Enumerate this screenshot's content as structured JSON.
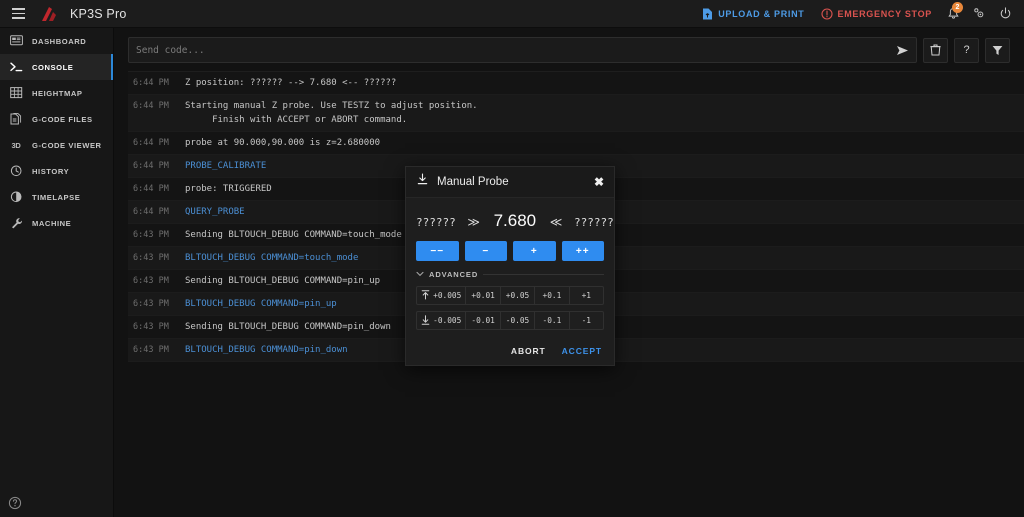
{
  "header": {
    "menu_icon": "hamburger-icon",
    "brand_title": "KP3S Pro",
    "upload_label": "UPLOAD & PRINT",
    "emergency_label": "EMERGENCY STOP",
    "notification_count": "2",
    "icons": [
      "bell-icon",
      "gear-icon",
      "power-icon"
    ]
  },
  "sidebar": {
    "items": [
      {
        "label": "DASHBOARD",
        "icon": "dashboard-icon",
        "active": false
      },
      {
        "label": "CONSOLE",
        "icon": "terminal-icon",
        "active": true
      },
      {
        "label": "HEIGHTMAP",
        "icon": "grid-icon",
        "active": false
      },
      {
        "label": "G-CODE FILES",
        "icon": "file-code-icon",
        "active": false
      },
      {
        "label": "G-CODE VIEWER",
        "icon": "3d-icon",
        "active": false
      },
      {
        "label": "HISTORY",
        "icon": "clock-icon",
        "active": false
      },
      {
        "label": "TIMELAPSE",
        "icon": "timelapse-icon",
        "active": false
      },
      {
        "label": "MACHINE",
        "icon": "wrench-icon",
        "active": false
      }
    ],
    "help_icon": "help-circle-icon"
  },
  "console": {
    "input_placeholder": "Send code...",
    "input_value": "",
    "send_icon": "send-icon",
    "tools": [
      {
        "icon": "trash-icon",
        "glyph": "Ὕ1"
      },
      {
        "icon": "help-icon",
        "glyph": "?"
      },
      {
        "icon": "filter-icon",
        "glyph": "filter"
      }
    ],
    "lines": [
      {
        "time": "6:44 PM",
        "text": "Z position: ?????? --> 7.680 <-- ??????",
        "sent": false
      },
      {
        "time": "6:44 PM",
        "text": "Starting manual Z probe. Use TESTZ to adjust position.\n     Finish with ACCEPT or ABORT command.",
        "sent": false
      },
      {
        "time": "6:44 PM",
        "text": "probe at 90.000,90.000 is z=2.680000",
        "sent": false
      },
      {
        "time": "6:44 PM",
        "text": "PROBE_CALIBRATE",
        "sent": true
      },
      {
        "time": "6:44 PM",
        "text": "probe: TRIGGERED",
        "sent": false
      },
      {
        "time": "6:44 PM",
        "text": "QUERY_PROBE",
        "sent": true
      },
      {
        "time": "6:43 PM",
        "text": "Sending BLTOUCH_DEBUG COMMAND=touch_mode",
        "sent": false
      },
      {
        "time": "6:43 PM",
        "text": "BLTOUCH_DEBUG COMMAND=touch_mode",
        "sent": true
      },
      {
        "time": "6:43 PM",
        "text": "Sending BLTOUCH_DEBUG COMMAND=pin_up",
        "sent": false
      },
      {
        "time": "6:43 PM",
        "text": "BLTOUCH_DEBUG COMMAND=pin_up",
        "sent": true
      },
      {
        "time": "6:43 PM",
        "text": "Sending BLTOUCH_DEBUG COMMAND=pin_down",
        "sent": false
      },
      {
        "time": "6:43 PM",
        "text": "BLTOUCH_DEBUG COMMAND=pin_down",
        "sent": true
      }
    ]
  },
  "dialog": {
    "title": "Manual Probe",
    "title_icon": "probe-down-icon",
    "close_icon": "close-icon",
    "readout": {
      "left": "??????",
      "left_arrow": "≫",
      "value": "7.680",
      "right_arrow": "≪",
      "right": "??????"
    },
    "step_buttons": [
      {
        "label": "−−"
      },
      {
        "label": "−"
      },
      {
        "label": "+"
      },
      {
        "label": "++"
      }
    ],
    "advanced": {
      "label": "ADVANCED",
      "chevron": "⌄",
      "up_row": [
        "+0.005",
        "+0.01",
        "+0.05",
        "+0.1",
        "+1"
      ],
      "down_row": [
        "-0.005",
        "-0.01",
        "-0.05",
        "-0.1",
        "-1"
      ],
      "up_icon": "arrow-up-bar-icon",
      "down_icon": "arrow-down-bar-icon"
    },
    "actions": {
      "abort": "ABORT",
      "accept": "ACCEPT"
    }
  },
  "colors": {
    "accent_blue": "#2f8cf0",
    "link_blue": "#4b8fd4",
    "danger_red": "#d9534f",
    "badge_orange": "#e8873a",
    "brand_red": "#c0272d"
  }
}
